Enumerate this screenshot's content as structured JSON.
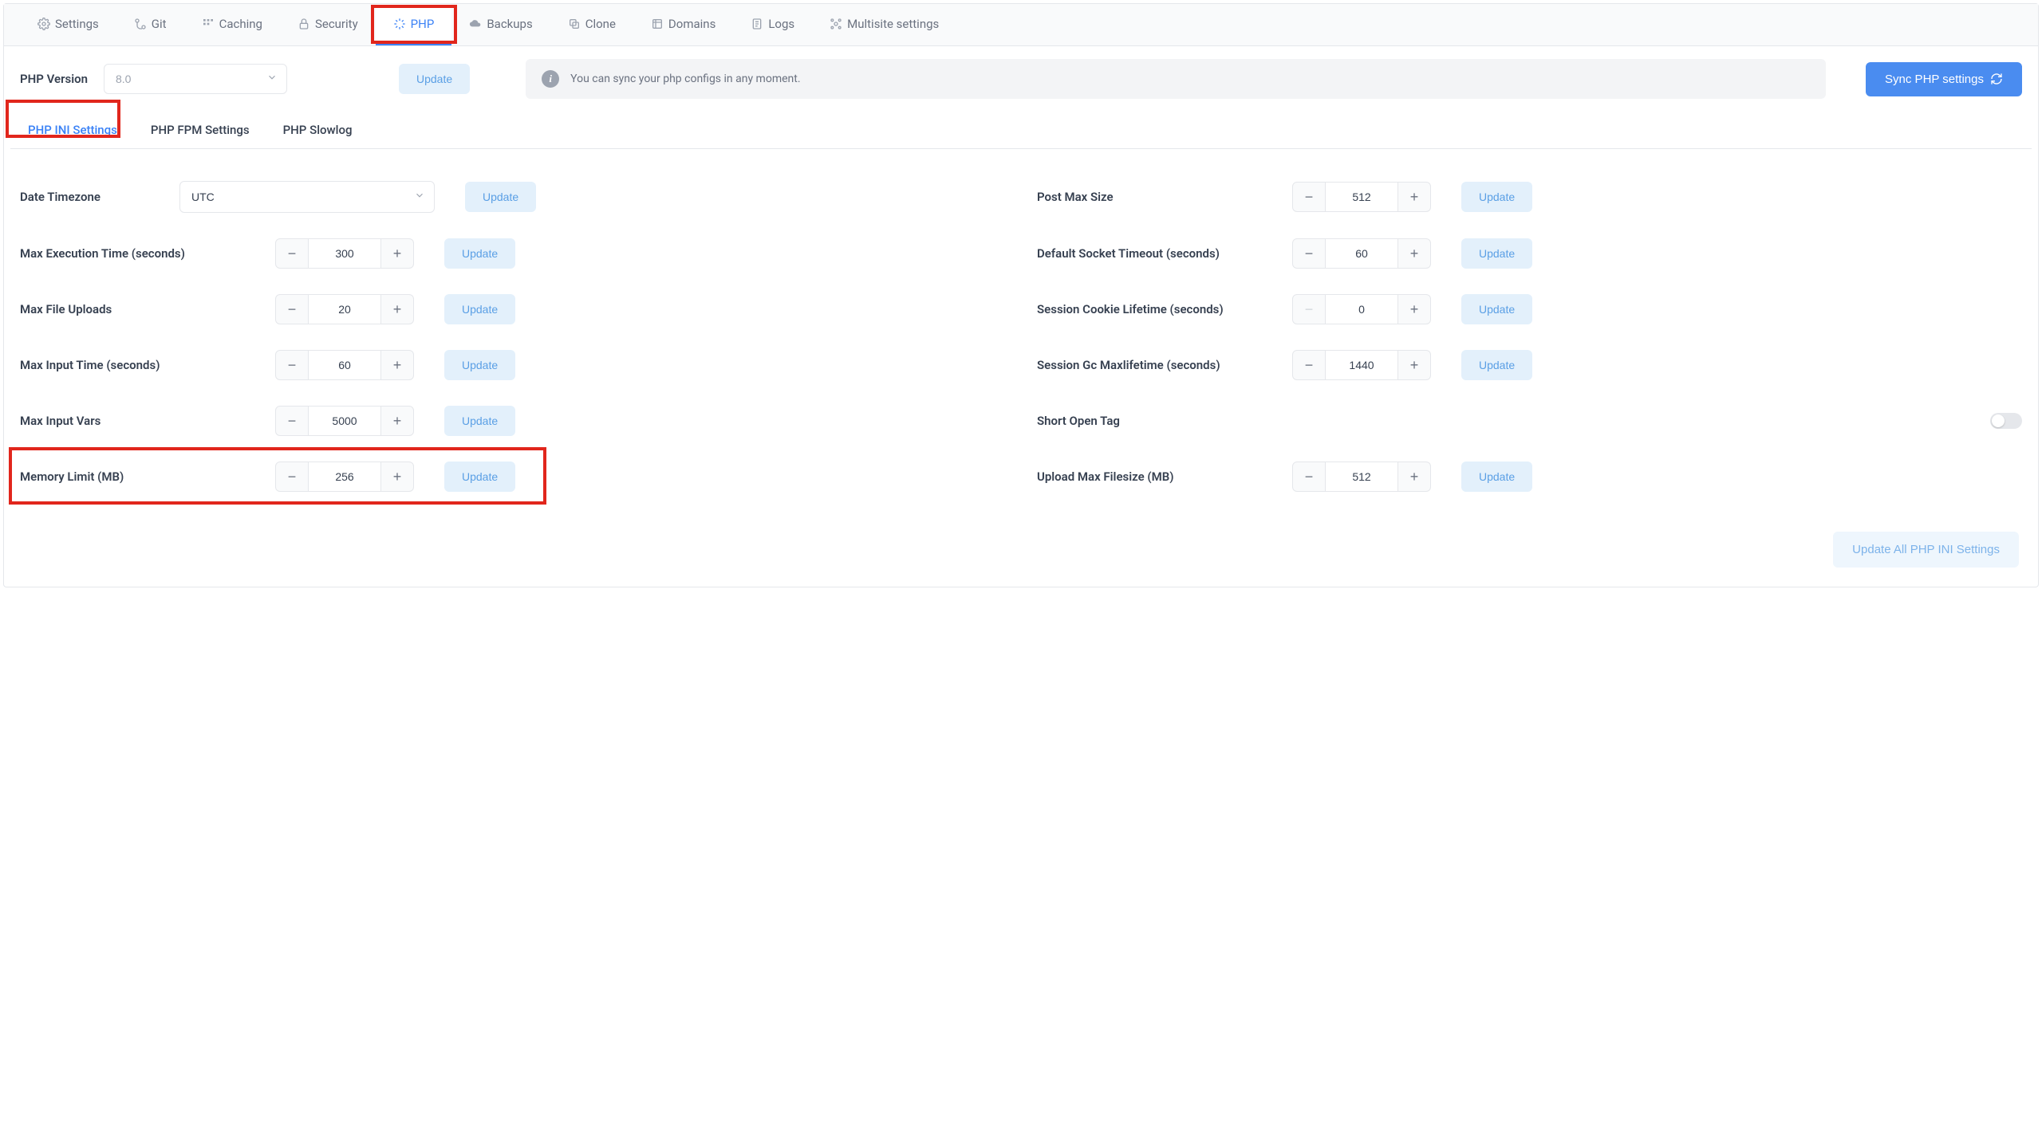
{
  "topnav": {
    "items": [
      {
        "icon": "gear",
        "label": "Settings"
      },
      {
        "icon": "git",
        "label": "Git"
      },
      {
        "icon": "cache",
        "label": "Caching"
      },
      {
        "icon": "lock",
        "label": "Security"
      },
      {
        "icon": "php",
        "label": "PHP",
        "active": true
      },
      {
        "icon": "cloud",
        "label": "Backups"
      },
      {
        "icon": "copy",
        "label": "Clone"
      },
      {
        "icon": "domain",
        "label": "Domains"
      },
      {
        "icon": "logs",
        "label": "Logs"
      },
      {
        "icon": "multi",
        "label": "Multisite settings"
      }
    ]
  },
  "version": {
    "label": "PHP Version",
    "value": "8.0",
    "update_label": "Update",
    "info_text": "You can sync your php configs in any moment.",
    "sync_label": "Sync PHP settings"
  },
  "subtabs": {
    "items": [
      {
        "label": "PHP INI Settings",
        "active": true
      },
      {
        "label": "PHP FPM Settings"
      },
      {
        "label": "PHP Slowlog"
      }
    ]
  },
  "settings": {
    "date_timezone": {
      "label": "Date Timezone",
      "value": "UTC",
      "update": "Update"
    },
    "post_max_size": {
      "label": "Post Max Size",
      "value": "512",
      "update": "Update"
    },
    "max_exec": {
      "label": "Max Execution Time (seconds)",
      "value": "300",
      "update": "Update"
    },
    "default_socket": {
      "label": "Default Socket Timeout (seconds)",
      "value": "60",
      "update": "Update"
    },
    "max_file_uploads": {
      "label": "Max File Uploads",
      "value": "20",
      "update": "Update"
    },
    "session_cookie": {
      "label": "Session Cookie Lifetime (seconds)",
      "value": "0",
      "update": "Update",
      "minus_disabled": true
    },
    "max_input_time": {
      "label": "Max Input Time (seconds)",
      "value": "60",
      "update": "Update"
    },
    "session_gc": {
      "label": "Session Gc Maxlifetime (seconds)",
      "value": "1440",
      "update": "Update"
    },
    "max_input_vars": {
      "label": "Max Input Vars",
      "value": "5000",
      "update": "Update"
    },
    "short_open_tag": {
      "label": "Short Open Tag",
      "on": false
    },
    "memory_limit": {
      "label": "Memory Limit (MB)",
      "value": "256",
      "update": "Update"
    },
    "upload_max": {
      "label": "Upload Max Filesize (MB)",
      "value": "512",
      "update": "Update"
    }
  },
  "footer": {
    "update_all_label": "Update All PHP INI Settings"
  }
}
